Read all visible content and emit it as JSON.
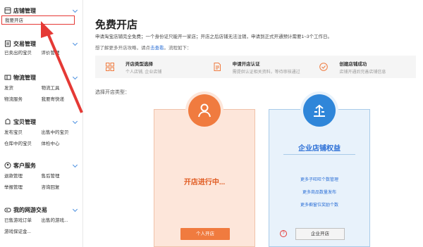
{
  "sidebar": {
    "sections": [
      {
        "title": "店铺管理",
        "icon": "store-icon",
        "items": [
          "我要开店"
        ]
      },
      {
        "title": "交易管理",
        "icon": "trade-icon",
        "items": [
          "已卖出的宝贝",
          "评价管理"
        ]
      },
      {
        "title": "物流管理",
        "icon": "logistics-icon",
        "items": [
          "发货",
          "物流工具",
          "物流服务",
          "我要寄快递"
        ]
      },
      {
        "title": "宝贝管理",
        "icon": "goods-icon",
        "items": [
          "发布宝贝",
          "出售中的宝贝",
          "仓库中的宝贝",
          "体检中心"
        ]
      },
      {
        "title": "客户服务",
        "icon": "service-icon",
        "items": [
          "退款管理",
          "售后管理",
          "举报管理",
          "咨询回复"
        ]
      },
      {
        "title": "我的网游交易",
        "icon": "game-icon",
        "items": [
          "已售游戏订单",
          "出售的游戏...",
          "游戏保证金..."
        ]
      }
    ]
  },
  "main": {
    "title": "免费开店",
    "desc1": "申请淘宝店铺完全免费；一个身份证只能开一家店；开店之后店铺无法注销，申请到正式开通预计需要1~3个工作日。",
    "desc2_prefix": "想了解更多开店攻略，请点",
    "desc2_link": "击查看",
    "desc2_suffix": "。流程如下：",
    "steps": [
      {
        "title": "开店类型选择",
        "sub": "个人店铺, 企业店铺",
        "icon": "grid-icon"
      },
      {
        "title": "申请开店认证",
        "sub": "需提供认证相关资料，等待审核通过",
        "icon": "document-icon"
      },
      {
        "title": "创建店铺成功",
        "sub": "店铺开通后完善店铺信息",
        "icon": "check-circle-icon"
      }
    ],
    "choose_label": "选择开店类型：",
    "personal": {
      "status": "开店进行中...",
      "button": "个人开店"
    },
    "enterprise": {
      "title": "企业店铺权益",
      "features": [
        "更多子旺旺个数管理",
        "更多商品数量发布",
        "更多橱窗位奖励个数"
      ],
      "button": "企业开店",
      "help": "?"
    }
  },
  "colors": {
    "accent_orange": "#f07b3f",
    "accent_blue": "#2f86d9",
    "highlight_red": "#e53935"
  }
}
